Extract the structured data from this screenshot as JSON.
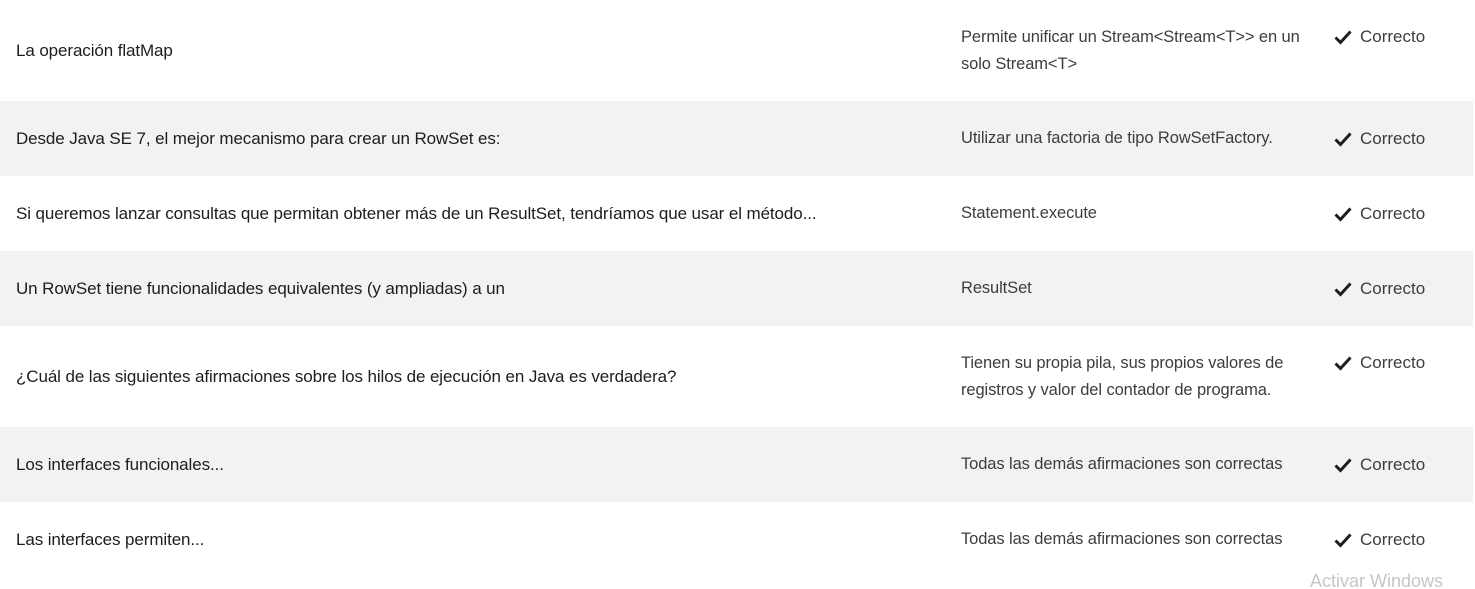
{
  "rows": [
    {
      "question": "La operación flatMap",
      "answer": "Permite unificar un Stream<Stream<T>> en un solo Stream<T>",
      "status": "Correcto"
    },
    {
      "question": "Desde Java SE 7, el mejor mecanismo para crear un RowSet es:",
      "answer": "Utilizar una factoria de tipo RowSetFactory.",
      "status": "Correcto"
    },
    {
      "question": "Si queremos lanzar consultas que permitan obtener más de un ResultSet, tendríamos que usar el método...",
      "answer": "Statement.execute",
      "status": "Correcto"
    },
    {
      "question": "Un RowSet tiene funcionalidades equivalentes (y ampliadas) a un",
      "answer": "ResultSet",
      "status": "Correcto"
    },
    {
      "question": "¿Cuál de las siguientes afirmaciones sobre los hilos de ejecución en Java es verdadera?",
      "answer": "Tienen su propia pila, sus propios valores de registros y valor del contador de programa.",
      "status": "Correcto"
    },
    {
      "question": "Los interfaces funcionales...",
      "answer": "Todas las demás afirmaciones son correctas",
      "status": "Correcto"
    },
    {
      "question": "Las interfaces permiten...",
      "answer": "Todas las demás afirmaciones son correctas",
      "status": "Correcto"
    }
  ],
  "status_icon": "check-icon",
  "watermark": "Activar Windows",
  "colors": {
    "row_alt": "#f2f2f2",
    "text": "#1c1d1f",
    "answer_text": "#3d3d3d",
    "check": "#1c1d1f"
  }
}
